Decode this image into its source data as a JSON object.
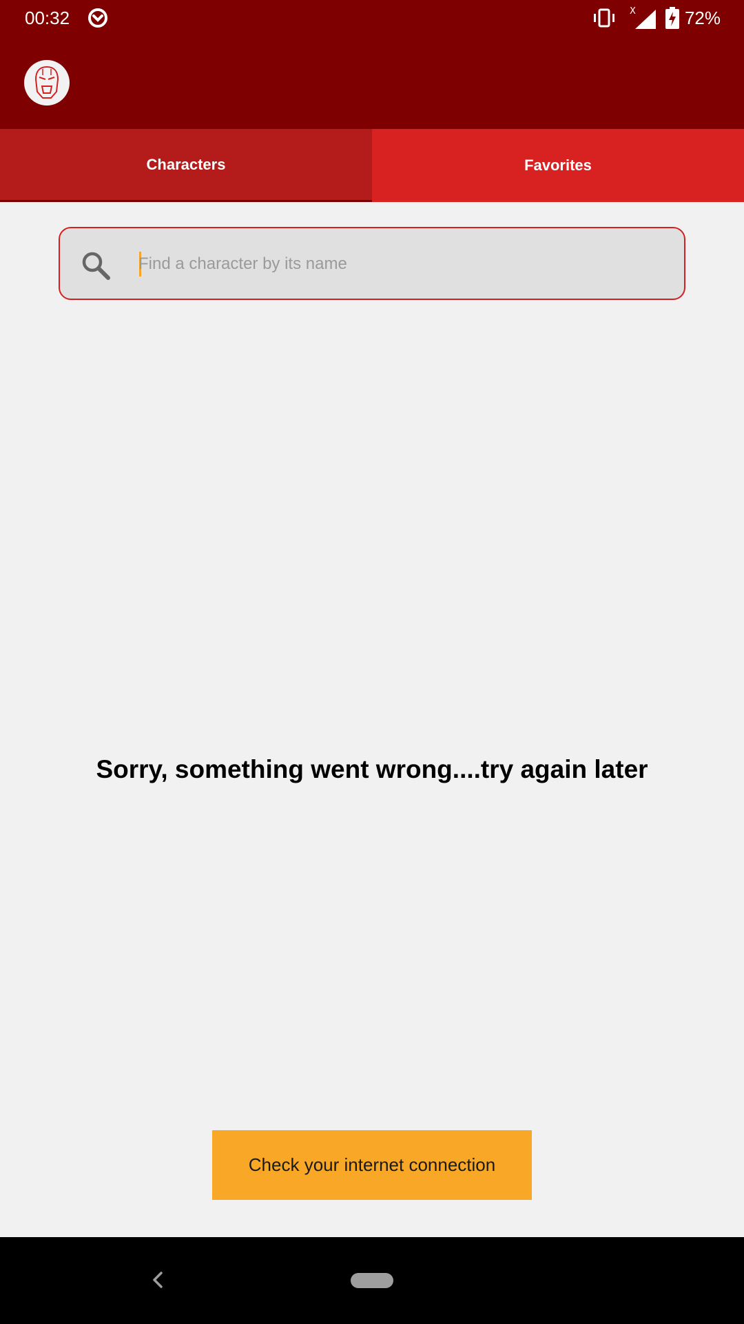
{
  "status_bar": {
    "time": "00:32",
    "battery": "72%",
    "icons": [
      "sync-icon",
      "vibrate-icon",
      "signal-icon",
      "battery-charging-icon"
    ]
  },
  "app_bar": {
    "logo_icon": "iron-man-helmet-icon"
  },
  "tabs": [
    {
      "label": "Characters",
      "selected": true
    },
    {
      "label": "Favorites",
      "selected": false
    }
  ],
  "search": {
    "placeholder": "Find a character by its name",
    "value": "",
    "icon": "search-icon"
  },
  "error": {
    "message": "Sorry, something went wrong....try again later"
  },
  "retry_button": {
    "label": "Check your internet connection"
  },
  "colors": {
    "app_bar": "#7f0000",
    "tab_selected": "#b41c1c",
    "tab_unselected": "#d82222",
    "search_border": "#d32020",
    "button": "#f8a826",
    "background": "#f1f1f1"
  },
  "nav_bar": {
    "icons": [
      "back-icon",
      "home-pill-icon"
    ]
  }
}
